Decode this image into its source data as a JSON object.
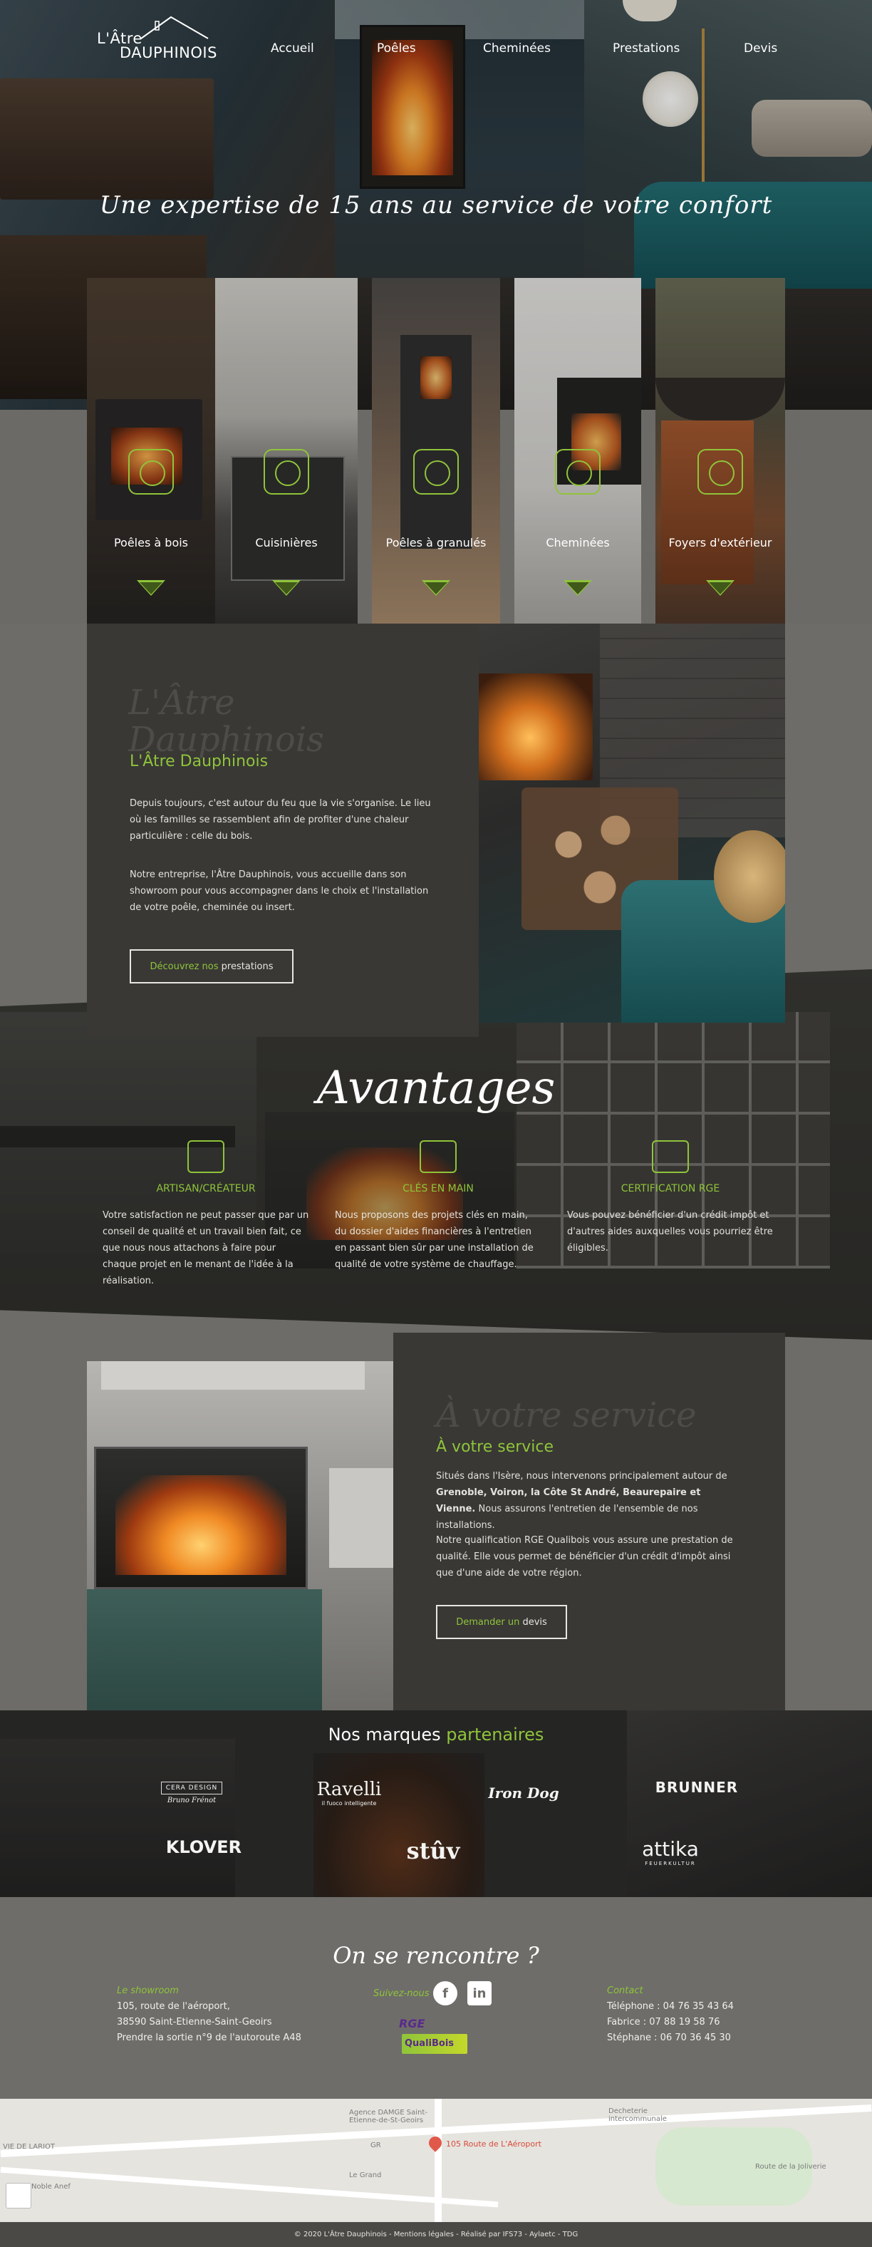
{
  "brand": {
    "line1": "L'Âtre",
    "line2": "DAUPHINOIS"
  },
  "nav": [
    {
      "label": "Accueil"
    },
    {
      "label": "Poêles"
    },
    {
      "label": "Cheminées"
    },
    {
      "label": "Prestations"
    },
    {
      "label": "Devis"
    }
  ],
  "hero": {
    "tagline": "Une expertise de 15 ans au service de votre confort"
  },
  "categories": [
    {
      "label": "Poêles à bois"
    },
    {
      "label": "Cuisinières"
    },
    {
      "label": "Poêles à granulés"
    },
    {
      "label": "Cheminées"
    },
    {
      "label": "Foyers d'extérieur"
    }
  ],
  "about": {
    "ghost_line1": "L'Âtre",
    "ghost_line2": "Dauphinois",
    "title": "L'Âtre Dauphinois",
    "para1": "Depuis toujours, c'est autour du feu que la vie s'organise. Le lieu où les familles se rassemblent afin de profiter d'une chaleur particulière : celle du bois.",
    "para2": "Notre entreprise, l'Âtre Dauphinois, vous accueille dans son showroom pour vous accompagner dans le choix et l'installation de votre poêle, cheminée ou insert.",
    "btn_pre": "Découvrez nos",
    "btn_main": "prestations"
  },
  "advantages": {
    "title": "Avantages",
    "items": [
      {
        "title": "ARTISAN/CRÉATEUR",
        "text": "Votre satisfaction ne peut passer que par un conseil de qualité et un travail bien fait, ce que nous nous attachons à faire pour chaque projet en le menant de l'idée à la réalisation."
      },
      {
        "title": "CLÉS EN MAIN",
        "text": "Nous proposons des projets clés en main, du dossier d'aides financières à l'entretien en passant bien sûr par une installation de qualité de votre système de chauffage."
      },
      {
        "title": "CERTIFICATION RGE",
        "text": "Vous pouvez bénéficier d'un crédit impôt et d'autres aides auxquelles vous pourriez être éligibles."
      }
    ]
  },
  "service": {
    "ghost": "À votre service",
    "title": "À votre service",
    "p1_a": "Situés dans l'Isère, nous intervenons principalement autour de",
    "p1_b": "Grenoble, Voiron, la Côte St André, Beaurepaire et Vienne.",
    "p1_c": "Nous assurons l'entretien de l'ensemble de nos installations.",
    "p2": "Notre qualification RGE Qualibois vous assure une prestation de qualité. Elle vous permet de bénéficier d'un crédit d'impôt ainsi que d'une aide de votre région.",
    "btn_pre": "Demander un",
    "btn_main": "devis"
  },
  "partners": {
    "title_a": "Nos marques",
    "title_b": "partenaires",
    "brands": [
      "CERA DESIGN",
      "Ravelli",
      "Iron Dog",
      "BRUNNER",
      "KLOVER",
      "stûv",
      "attika"
    ],
    "ravelli_sub": "il fuoco intelligente",
    "cera_sub": "Bruno Frénot",
    "attika_sub": "FEUERKULTUR"
  },
  "contact": {
    "title": "On se rencontre ?",
    "showroom_label": "Le showroom",
    "showroom_lines": [
      "105, route de l'aéroport,",
      "38590 Saint-Etienne-Saint-Geoirs",
      "Prendre la sortie n°9 de l'autoroute A48"
    ],
    "follow_label": "Suivez-nous",
    "social": [
      "f",
      "in"
    ],
    "rge_text": "RGE",
    "qualibois_text": "QualiBois",
    "contact_label": "Contact",
    "lines": [
      "Téléphone : 04 76 35 43 64",
      "Fabrice : 07 88 19 58 76",
      "Stéphane : 06 70 36 45 30"
    ]
  },
  "map": {
    "labels": [
      "VIE DE LARIOT",
      "Agence DAMGE Saint-Etienne-de-St-Geoirs",
      "Decheterie intercommunale",
      "Route de la Joliverie",
      "Noble Anef",
      "Le Grand",
      "GR"
    ],
    "pin_label": "105 Route de L'Aéroport"
  },
  "footer": {
    "text": "© 2020 L'Âtre Dauphinois - Mentions légales - Réalisé par IFS73 - Aylaetc - TDG"
  },
  "colors": {
    "accent": "#8fc43a",
    "panel": "#393835",
    "page": "#6d6c68"
  }
}
